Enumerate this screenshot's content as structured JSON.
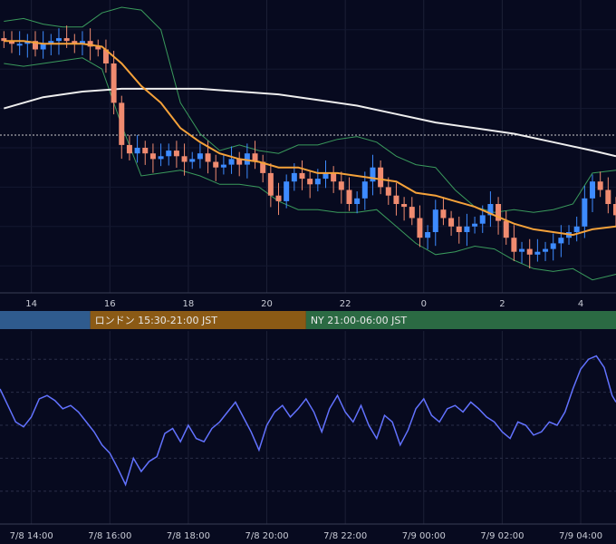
{
  "chart_data": [
    {
      "type": "line",
      "panel": "price",
      "x_ticks": [
        "14",
        "16",
        "18",
        "20",
        "22",
        "0",
        "2",
        "4"
      ],
      "x_hours": [
        14,
        16,
        18,
        20,
        22,
        24,
        26,
        28
      ],
      "x_range": [
        13.2,
        28.9
      ],
      "y_range": [
        0,
        1
      ],
      "grid": true,
      "reference_line": 0.545,
      "series": [
        {
          "kind": "candlestick",
          "up_color": "#3d8bff",
          "down_color": "#f08b70",
          "x": [
            13.3,
            13.5,
            13.7,
            13.9,
            14.1,
            14.3,
            14.5,
            14.7,
            14.9,
            15.1,
            15.3,
            15.5,
            15.7,
            15.9,
            16.1,
            16.3,
            16.5,
            16.7,
            16.9,
            17.1,
            17.3,
            17.5,
            17.7,
            17.9,
            18.1,
            18.3,
            18.5,
            18.7,
            18.9,
            19.1,
            19.3,
            19.5,
            19.7,
            19.9,
            20.1,
            20.3,
            20.5,
            20.7,
            20.9,
            21.1,
            21.3,
            21.5,
            21.7,
            21.9,
            22.1,
            22.3,
            22.5,
            22.7,
            22.9,
            23.1,
            23.3,
            23.5,
            23.7,
            23.9,
            24.1,
            24.3,
            24.5,
            24.7,
            24.9,
            25.1,
            25.3,
            25.5,
            25.7,
            25.9,
            26.1,
            26.3,
            26.5,
            26.7,
            26.9,
            27.1,
            27.3,
            27.5,
            27.7,
            27.9,
            28.1,
            28.3,
            28.5,
            28.7,
            28.9
          ],
          "close": [
            0.88,
            0.87,
            0.87,
            0.88,
            0.85,
            0.87,
            0.88,
            0.89,
            0.88,
            0.87,
            0.88,
            0.86,
            0.85,
            0.8,
            0.66,
            0.51,
            0.48,
            0.5,
            0.48,
            0.46,
            0.47,
            0.49,
            0.47,
            0.45,
            0.46,
            0.48,
            0.45,
            0.43,
            0.44,
            0.46,
            0.44,
            0.48,
            0.45,
            0.41,
            0.33,
            0.31,
            0.38,
            0.41,
            0.39,
            0.37,
            0.39,
            0.41,
            0.38,
            0.35,
            0.3,
            0.32,
            0.38,
            0.43,
            0.36,
            0.33,
            0.3,
            0.29,
            0.25,
            0.18,
            0.2,
            0.28,
            0.25,
            0.22,
            0.2,
            0.22,
            0.23,
            0.26,
            0.3,
            0.24,
            0.18,
            0.13,
            0.14,
            0.12,
            0.13,
            0.14,
            0.16,
            0.18,
            0.2,
            0.22,
            0.32,
            0.38,
            0.35,
            0.3,
            0.26
          ]
        },
        {
          "kind": "moving-average",
          "color": "#f5a23a",
          "x": [
            13.3,
            13.8,
            14.3,
            14.8,
            15.3,
            15.8,
            16.3,
            16.8,
            17.3,
            17.8,
            18.3,
            18.8,
            19.3,
            19.8,
            20.3,
            20.8,
            21.3,
            21.8,
            22.3,
            22.8,
            23.3,
            23.8,
            24.3,
            24.8,
            25.3,
            25.8,
            26.3,
            26.8,
            27.3,
            27.8,
            28.3,
            28.9
          ],
          "y": [
            0.88,
            0.88,
            0.87,
            0.87,
            0.87,
            0.86,
            0.8,
            0.72,
            0.66,
            0.57,
            0.52,
            0.48,
            0.46,
            0.45,
            0.43,
            0.43,
            0.41,
            0.41,
            0.4,
            0.39,
            0.38,
            0.34,
            0.33,
            0.31,
            0.29,
            0.26,
            0.23,
            0.21,
            0.2,
            0.19,
            0.21,
            0.22
          ]
        },
        {
          "kind": "long-moving-average",
          "color": "#eeeeee",
          "x": [
            13.3,
            14.3,
            15.3,
            16.3,
            17.3,
            18.3,
            19.3,
            20.3,
            21.3,
            22.3,
            23.3,
            24.3,
            25.3,
            26.3,
            27.3,
            28.3,
            28.9
          ],
          "y": [
            0.64,
            0.68,
            0.7,
            0.71,
            0.71,
            0.71,
            0.7,
            0.69,
            0.67,
            0.65,
            0.62,
            0.59,
            0.57,
            0.55,
            0.52,
            0.49,
            0.47
          ]
        },
        {
          "kind": "bollinger-upper",
          "color": "#3a9a5c",
          "x": [
            13.3,
            13.8,
            14.3,
            14.8,
            15.3,
            15.8,
            16.3,
            16.8,
            17.3,
            17.8,
            18.3,
            18.8,
            19.3,
            19.8,
            20.3,
            20.8,
            21.3,
            21.8,
            22.3,
            22.8,
            23.3,
            23.8,
            24.3,
            24.8,
            25.3,
            25.8,
            26.3,
            26.8,
            27.3,
            27.8,
            28.3,
            28.9
          ],
          "y": [
            0.95,
            0.96,
            0.94,
            0.93,
            0.93,
            0.98,
            1.0,
            0.99,
            0.92,
            0.66,
            0.55,
            0.49,
            0.51,
            0.49,
            0.48,
            0.51,
            0.51,
            0.53,
            0.54,
            0.52,
            0.47,
            0.44,
            0.43,
            0.35,
            0.29,
            0.27,
            0.28,
            0.27,
            0.28,
            0.3,
            0.41,
            0.42
          ]
        },
        {
          "kind": "bollinger-lower",
          "color": "#3a9a5c",
          "x": [
            13.3,
            13.8,
            14.3,
            14.8,
            15.3,
            15.8,
            16.3,
            16.8,
            17.3,
            17.8,
            18.3,
            18.8,
            19.3,
            19.8,
            20.3,
            20.8,
            21.3,
            21.8,
            22.3,
            22.8,
            23.3,
            23.8,
            24.3,
            24.8,
            25.3,
            25.8,
            26.3,
            26.8,
            27.3,
            27.8,
            28.3,
            28.9
          ],
          "y": [
            0.8,
            0.79,
            0.8,
            0.81,
            0.82,
            0.78,
            0.58,
            0.4,
            0.41,
            0.42,
            0.4,
            0.37,
            0.37,
            0.36,
            0.31,
            0.28,
            0.28,
            0.27,
            0.27,
            0.28,
            0.22,
            0.16,
            0.12,
            0.13,
            0.15,
            0.14,
            0.1,
            0.07,
            0.06,
            0.07,
            0.03,
            0.05
          ]
        }
      ]
    },
    {
      "type": "line",
      "panel": "oscillator",
      "x_ticks": [
        "7/8 14:00",
        "7/8 16:00",
        "7/8 18:00",
        "7/8 20:00",
        "7/8 22:00",
        "7/9 00:00",
        "7/9 02:00",
        "7/9 04:00"
      ],
      "x_hours": [
        14,
        16,
        18,
        20,
        22,
        24,
        26,
        28
      ],
      "x_range": [
        13.2,
        28.9
      ],
      "y_range": [
        0,
        1
      ],
      "grid": true,
      "series": [
        {
          "color": "#6272ff",
          "x": [
            13.2,
            13.4,
            13.6,
            13.8,
            14.0,
            14.2,
            14.4,
            14.6,
            14.8,
            15.0,
            15.2,
            15.4,
            15.6,
            15.8,
            16.0,
            16.2,
            16.4,
            16.6,
            16.8,
            17.0,
            17.2,
            17.4,
            17.6,
            17.8,
            18.0,
            18.2,
            18.4,
            18.6,
            18.8,
            19.0,
            19.2,
            19.4,
            19.6,
            19.8,
            20.0,
            20.2,
            20.4,
            20.6,
            20.8,
            21.0,
            21.2,
            21.4,
            21.6,
            21.8,
            22.0,
            22.2,
            22.4,
            22.6,
            22.8,
            23.0,
            23.2,
            23.4,
            23.6,
            23.8,
            24.0,
            24.2,
            24.4,
            24.6,
            24.8,
            25.0,
            25.2,
            25.4,
            25.6,
            25.8,
            26.0,
            26.2,
            26.4,
            26.6,
            26.8,
            27.0,
            27.2,
            27.4,
            27.6,
            27.8,
            28.0,
            28.2,
            28.4,
            28.6,
            28.8,
            28.9
          ],
          "y": [
            0.72,
            0.62,
            0.52,
            0.49,
            0.55,
            0.66,
            0.68,
            0.65,
            0.6,
            0.62,
            0.58,
            0.52,
            0.46,
            0.38,
            0.33,
            0.24,
            0.14,
            0.3,
            0.22,
            0.28,
            0.31,
            0.45,
            0.48,
            0.4,
            0.5,
            0.42,
            0.4,
            0.48,
            0.52,
            0.58,
            0.64,
            0.55,
            0.46,
            0.35,
            0.5,
            0.58,
            0.62,
            0.55,
            0.6,
            0.66,
            0.58,
            0.46,
            0.6,
            0.68,
            0.58,
            0.52,
            0.62,
            0.5,
            0.42,
            0.56,
            0.52,
            0.38,
            0.47,
            0.6,
            0.66,
            0.56,
            0.52,
            0.6,
            0.62,
            0.58,
            0.64,
            0.6,
            0.55,
            0.52,
            0.46,
            0.42,
            0.52,
            0.5,
            0.44,
            0.46,
            0.52,
            0.5,
            0.58,
            0.72,
            0.84,
            0.9,
            0.92,
            0.85,
            0.68,
            0.64
          ]
        }
      ]
    }
  ],
  "sessions": [
    {
      "label": "",
      "color": "#2f5b8e",
      "start_hour": 13.2,
      "end_hour": 15.5
    },
    {
      "label": "ロンドン 15:30-21:00 JST",
      "color": "#8b5a15",
      "start_hour": 15.5,
      "end_hour": 21.0
    },
    {
      "label": "NY 21:00-06:00 JST",
      "color": "#2b6a43",
      "start_hour": 21.0,
      "end_hour": 28.9
    }
  ]
}
